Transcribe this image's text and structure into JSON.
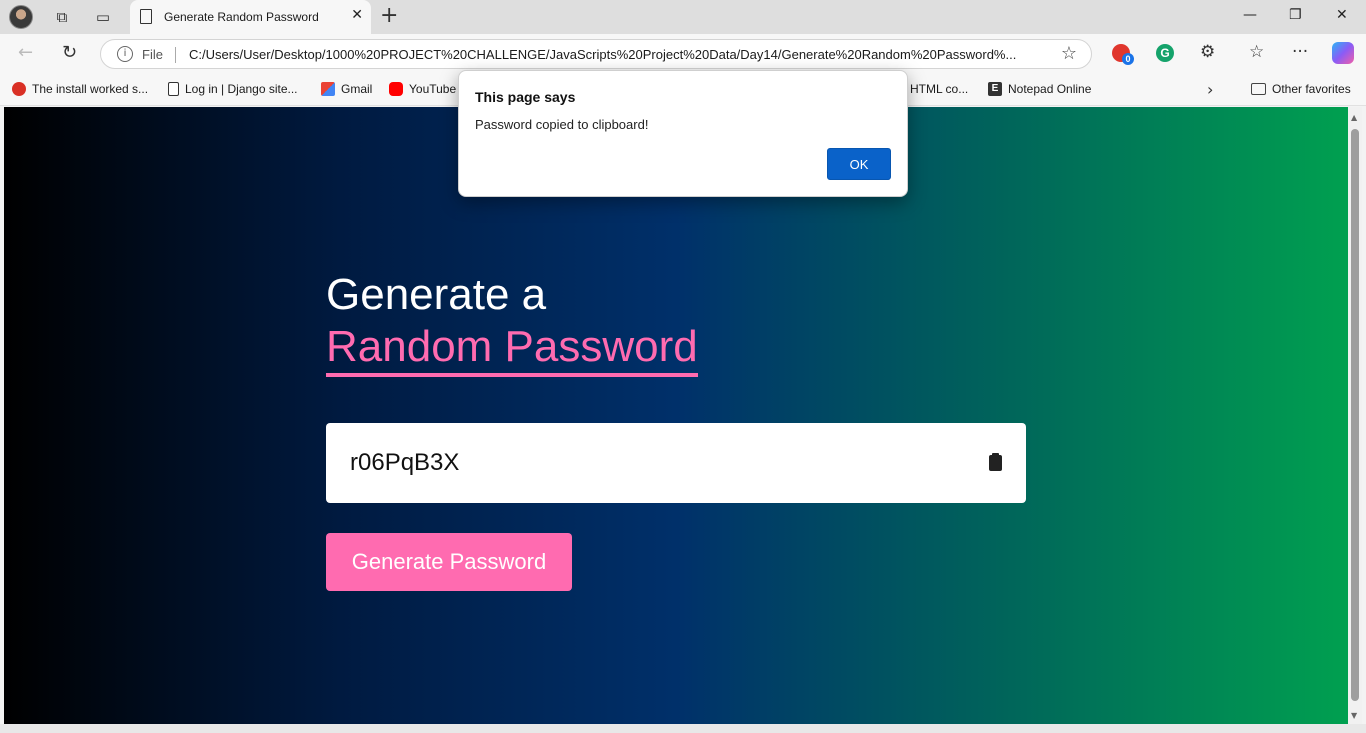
{
  "tab": {
    "title": "Generate Random Password",
    "close": "✕"
  },
  "window": {
    "new_tab": "+",
    "minimize": "—",
    "restore": "❐",
    "close": "✕"
  },
  "nav": {
    "back": "←",
    "reload": "↻",
    "scheme": "File",
    "url": "C:/Users/User/Desktop/1000%20PROJECT%20CHALLENGE/JavaScripts%20Project%20Data/Day14/Generate%20Random%20Password%...",
    "favorite_icon": "☆",
    "extension_badge_count": "0",
    "grammarly": "G",
    "extensions": "⚙",
    "favorites": "☆",
    "more": "···"
  },
  "bookmarks": [
    {
      "label": "The install worked s...",
      "icon": "django-red-icon"
    },
    {
      "label": "Log in | Django site...",
      "icon": "page-icon"
    },
    {
      "label": "Gmail",
      "icon": "gmail-icon"
    },
    {
      "label": "YouTube",
      "icon": "youtube-icon"
    },
    {
      "label": "HTML co...",
      "icon": "page-icon"
    },
    {
      "label": "Notepad Online",
      "icon": "notepad-e-icon"
    },
    {
      "label": "Other favorites",
      "icon": "folder-icon"
    }
  ],
  "bookmarks_more": "›",
  "bookmark_e_glyph": "E",
  "page": {
    "heading_line1": "Generate a",
    "heading_line2": "Random Password",
    "password_value": "r06PqB3X",
    "generate_button": "Generate Password",
    "colors": {
      "accent": "#ff6bb0",
      "bg_start": "#000000",
      "bg_mid": "#00306a",
      "bg_end": "#00a050"
    }
  },
  "dialog": {
    "title": "This page says",
    "message": "Password copied to clipboard!",
    "ok": "OK"
  },
  "scrollbar": {
    "up": "▲",
    "down": "▼"
  }
}
